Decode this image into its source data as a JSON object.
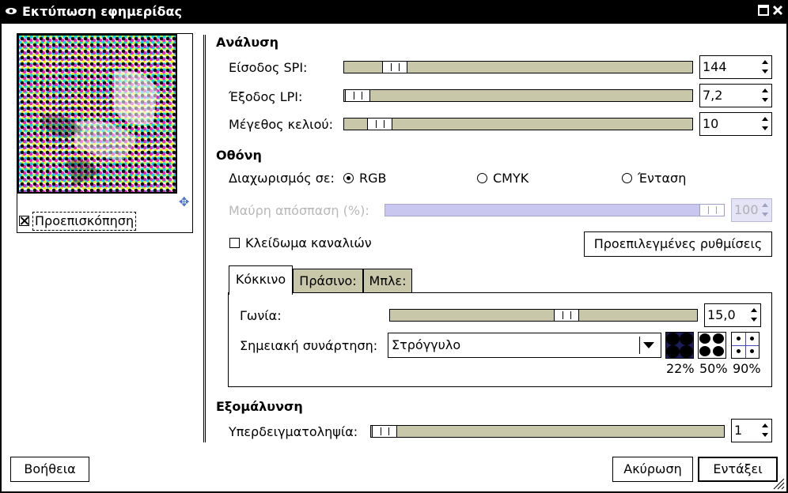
{
  "window": {
    "title": "Εκτύπωση εφημερίδας"
  },
  "preview": {
    "label": "Προεπισκόπηση",
    "checked": true
  },
  "resolution": {
    "heading": "Ανάλυση",
    "input_spi": {
      "label": "Είσοδος SPI:",
      "value": "144"
    },
    "output_lpi": {
      "label": "Έξοδος LPI:",
      "value": "7,2"
    },
    "cell_size": {
      "label": "Μέγεθος κελιού:",
      "value": "10"
    }
  },
  "screen": {
    "heading": "Οθόνη",
    "separate_label": "Διαχωρισμός σε:",
    "options": [
      "RGB",
      "CMYK",
      "Ένταση"
    ],
    "selected": "RGB",
    "black_pullout": {
      "label": "Μαύρη απόσπαση (%):",
      "value": "100"
    },
    "lock_channels": {
      "label": "Κλείδωμα καναλιών",
      "checked": false
    },
    "defaults_button": "Προεπιλεγμένες ρυθμίσεις",
    "tabs": [
      "Κόκκινο",
      "Πράσινο:",
      "Μπλε:"
    ],
    "active_tab": "Κόκκινο",
    "angle": {
      "label": "Γωνία:",
      "value": "15,0"
    },
    "spot_function": {
      "label": "Σημειακή συνάρτηση:",
      "value": "Στρόγγυλο"
    },
    "spot_previews": [
      "22%",
      "50%",
      "90%"
    ]
  },
  "antialiasing": {
    "heading": "Εξομάλυνση",
    "oversample": {
      "label": "Υπερδειγματοληψία:",
      "value": "1"
    }
  },
  "buttons": {
    "help": "Βοήθεια",
    "cancel": "Ακύρωση",
    "ok": "Εντάξει"
  }
}
